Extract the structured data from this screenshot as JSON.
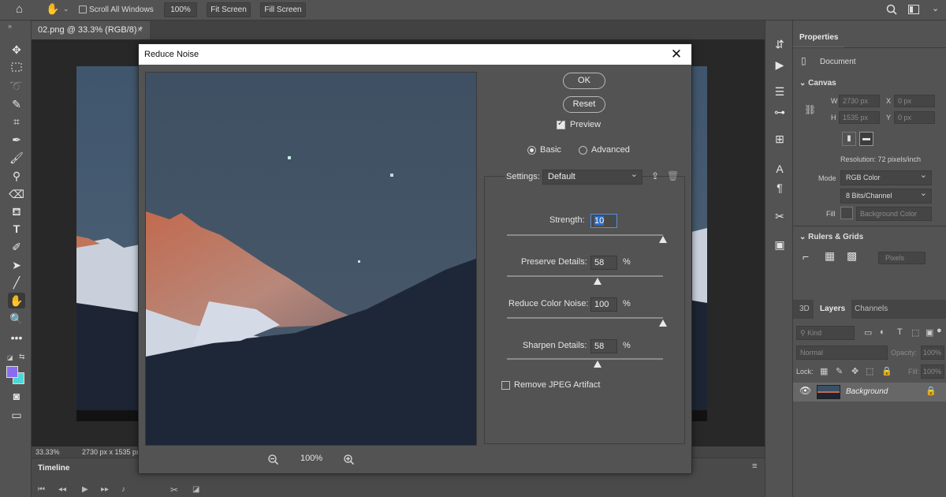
{
  "optionsbar": {
    "scroll_all_label": "Scroll All Windows",
    "zoom_100": "100%",
    "fit_screen": "Fit Screen",
    "fill_screen": "Fill Screen"
  },
  "document": {
    "tab_title": "02.png @ 33.3% (RGB/8) *",
    "status_zoom": "33.33%",
    "status_size": "2730 px x 1535 px"
  },
  "timeline": {
    "title": "Timeline"
  },
  "dialog": {
    "title": "Reduce Noise",
    "ok": "OK",
    "reset": "Reset",
    "preview_label": "Preview",
    "preview_checked": true,
    "mode_basic": "Basic",
    "mode_advanced": "Advanced",
    "selected_mode": "Basic",
    "settings_label": "Settings:",
    "settings_value": "Default",
    "strength_label": "Strength:",
    "strength_value": "10",
    "preserve_label": "Preserve Details:",
    "preserve_value": "58",
    "color_noise_label": "Reduce Color Noise:",
    "color_noise_value": "100",
    "sharpen_label": "Sharpen Details:",
    "sharpen_value": "58",
    "percent": "%",
    "jpeg_label": "Remove JPEG Artifact",
    "jpeg_checked": false,
    "zoom_value": "100%",
    "sliders": {
      "strength_frac": 1.0,
      "preserve_frac": 0.58,
      "color_noise_frac": 1.0,
      "sharpen_frac": 0.58
    }
  },
  "properties": {
    "tab": "Properties",
    "document_label": "Document",
    "canvas_header": "Canvas",
    "w_label": "W",
    "w_value": "2730 px",
    "h_label": "H",
    "h_value": "1535 px",
    "x_label": "X",
    "x_value": "0 px",
    "y_label": "Y",
    "y_value": "0 px",
    "resolution": "Resolution: 72 pixels/inch",
    "mode_label": "Mode",
    "mode_value": "RGB Color",
    "bits_value": "8 Bits/Channel",
    "fill_label": "Fill",
    "fill_value": "Background Color",
    "rulers_header": "Rulers & Grids",
    "units_value": "Pixels"
  },
  "layers": {
    "tabs": [
      "3D",
      "Layers",
      "Channels"
    ],
    "active_tab": "Layers",
    "kind_label": "Kind",
    "blend_mode": "Normal",
    "opacity_label": "Opacity:",
    "opacity_value": "100%",
    "lock_label": "Lock:",
    "fill_label": "Fill:",
    "fill_value": "100%",
    "layer_name": "Background"
  },
  "colors": {
    "foreground": "#8a6cf0",
    "background": "#4fd6d8"
  }
}
